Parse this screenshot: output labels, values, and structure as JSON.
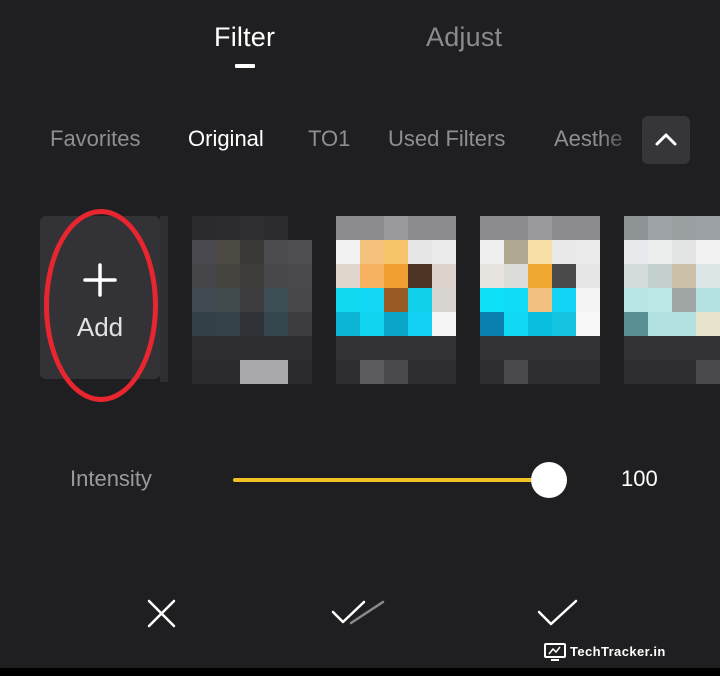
{
  "tabs": {
    "filter": "Filter",
    "adjust": "Adjust",
    "active": "Filter"
  },
  "categories": [
    {
      "label": "Favorites",
      "active": false
    },
    {
      "label": "Original",
      "active": true
    },
    {
      "label": "TO1",
      "active": false
    },
    {
      "label": "Used Filters",
      "active": false
    },
    {
      "label": "Aesthe",
      "active": false
    }
  ],
  "collapse_icon": "chevron-up-icon",
  "add_tile": {
    "label": "Add",
    "icon": "plus-icon",
    "highlight_color": "#e8262f"
  },
  "intensity": {
    "label": "Intensity",
    "value": "100",
    "level_percent": 100,
    "accent_color": "#f0c224"
  },
  "actions": {
    "cancel_icon": "close-icon",
    "apply_all_icon": "double-check-icon",
    "confirm_icon": "check-icon"
  },
  "watermark": {
    "text": "TechTracker.in"
  },
  "colors": {
    "background": "#1f1f21",
    "tile": "#333337",
    "accent": "#f0c224"
  }
}
